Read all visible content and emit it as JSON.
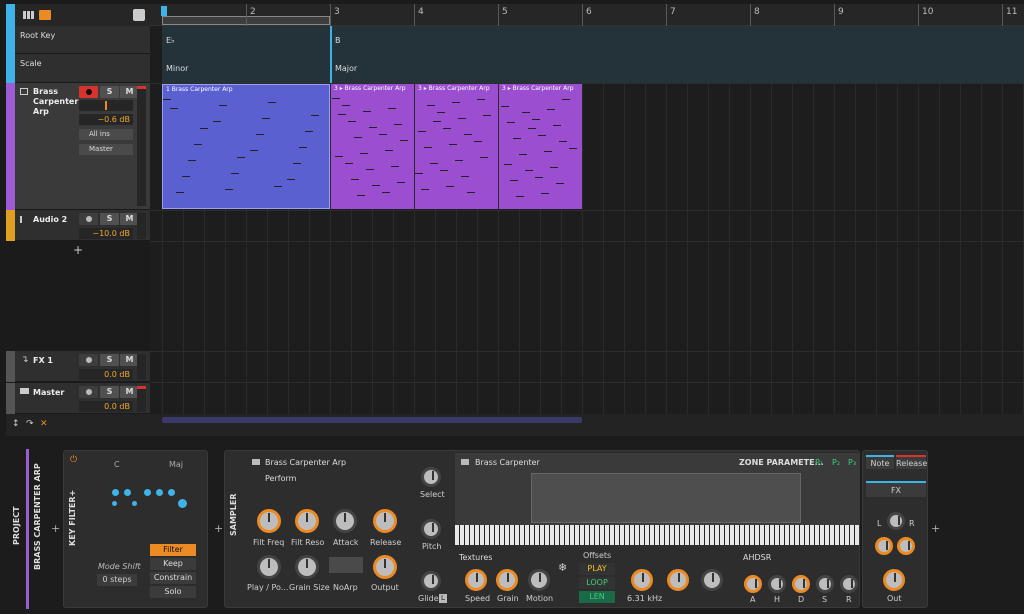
{
  "ruler": {
    "bars": [
      "2",
      "3",
      "4",
      "5",
      "6",
      "7",
      "8",
      "9",
      "10",
      "11"
    ]
  },
  "root_key_track": {
    "label": "Root Key",
    "keys": [
      "E♭",
      "B"
    ]
  },
  "scale_track": {
    "label": "Scale",
    "scales": [
      "Minor",
      "Major"
    ]
  },
  "tracks": [
    {
      "name": "Brass Carpenter Arp",
      "volume": "−0.6 dB",
      "input": "All ins",
      "output": "Master",
      "record": "●",
      "solo": "S",
      "mute": "M",
      "color": "#9b5cd4"
    },
    {
      "name": "Audio 2",
      "volume": "−10.0 dB",
      "record": "●",
      "solo": "S",
      "mute": "M",
      "color": "#e0a020"
    }
  ],
  "fx_track": {
    "name": "FX 1",
    "volume": "0.0 dB",
    "record": "●",
    "solo": "S",
    "mute": "M"
  },
  "master_track": {
    "name": "Master",
    "volume": "0.0 dB",
    "record": "●",
    "solo": "S",
    "mute": "M"
  },
  "clips": [
    {
      "title": "1 Brass Carpenter Arp"
    },
    {
      "title": "3 ▸ Brass Carpenter Arp"
    },
    {
      "title": "3 ▸ Brass Carpenter Arp"
    },
    {
      "title": "3 ▸ Brass Carpenter Arp"
    }
  ],
  "add_track": "+",
  "device_bar": {
    "project_label": "PROJECT",
    "track_label": "BRASS CARPENTER ARP",
    "key_filter": {
      "title": "KEY FILTER+",
      "root": "C",
      "scale": "Maj",
      "mode_shift_label": "Mode Shift",
      "mode_shift_value": "0 steps",
      "buttons": [
        "Filter",
        "Keep",
        "Constrain",
        "Solo"
      ],
      "active_button": "Filter"
    },
    "sampler": {
      "title": "SAMPLER",
      "preset": "Brass Carpenter Arp",
      "page": "Perform",
      "knobs": [
        "Filt Freq",
        "Filt Reso",
        "Attack",
        "Release",
        "Play / Po...",
        "Grain Size",
        "NoArp",
        "Output"
      ],
      "side_knobs": [
        "Select",
        "Pitch",
        "Glide"
      ],
      "glide_badge": "L",
      "sample_name": "Brass Carpenter",
      "zone_params": "ZONE PARAMETE...",
      "p_buttons": [
        "P₁",
        "P₂",
        "P₃"
      ],
      "textures_label": "Textures",
      "texture_knobs": [
        "Speed",
        "Grain",
        "Motion"
      ],
      "offsets_label": "Offsets",
      "offset_modes": [
        "PLAY",
        "LOOP",
        "LEN"
      ],
      "filter_freq": "6.31 kHz",
      "envelope_label": "AHDSR",
      "env_knobs": [
        "A",
        "H",
        "D",
        "S",
        "R"
      ]
    },
    "modulators": {
      "note_label": "Note",
      "release_label": "Release",
      "fx_label": "FX",
      "l_label": "L",
      "r_label": "R",
      "out_label": "Out"
    }
  },
  "colors": {
    "accent": "#ec8a23",
    "clip_blue": "#5a60d0",
    "clip_purple": "#9b4ed0",
    "selection": "#3fb3e8"
  }
}
